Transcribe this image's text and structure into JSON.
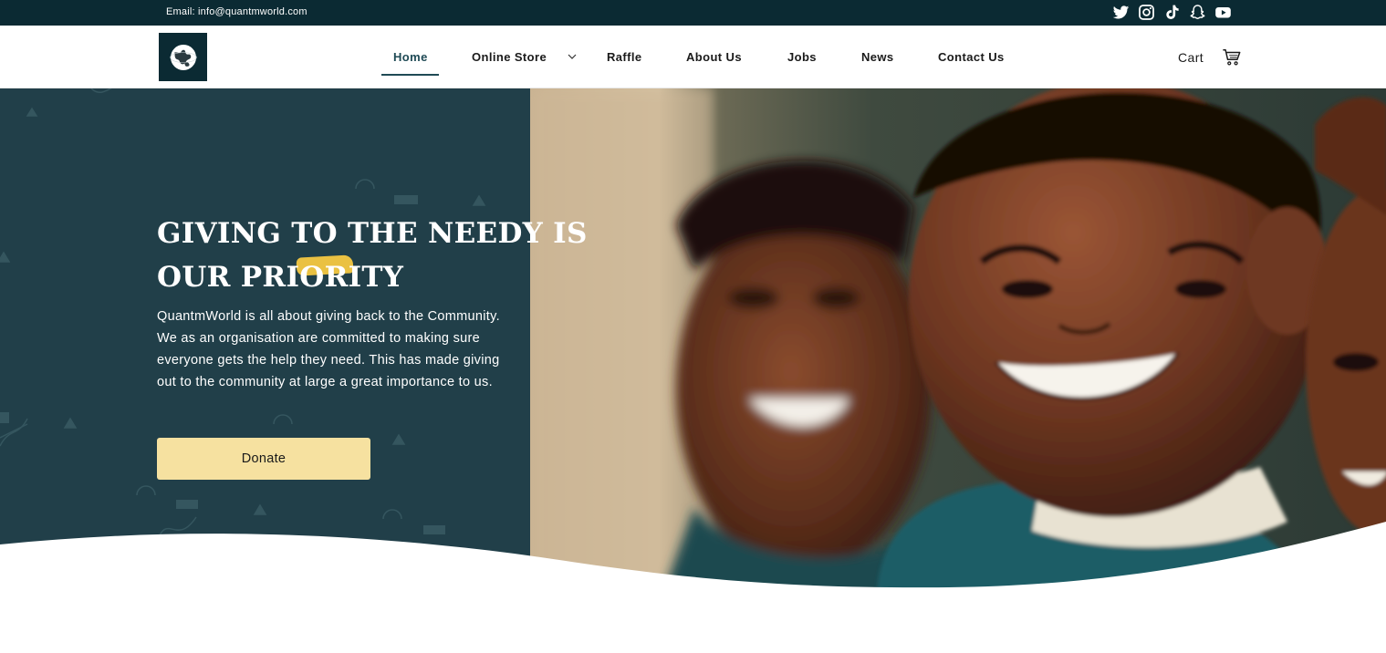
{
  "topbar": {
    "email": "Email: info@quantmworld.com",
    "social_icons": [
      "twitter-icon",
      "instagram-icon",
      "tiktok-icon",
      "snapchat-icon",
      "youtube-icon"
    ]
  },
  "header": {
    "logo_icon": "globe-logo-icon",
    "nav": [
      {
        "label": "Home",
        "active": true
      },
      {
        "label": "Online Store",
        "has_dropdown": true
      },
      {
        "label": "Raffle"
      },
      {
        "label": "About Us"
      },
      {
        "label": "Jobs"
      },
      {
        "label": "News"
      },
      {
        "label": "Contact Us"
      }
    ],
    "cart_label": "Cart",
    "cart_icon": "cart-icon"
  },
  "hero": {
    "title_line1": "Giving to the needy is",
    "title_line2": "our priority",
    "description": "QuantmWorld is all about giving back to the Community. We as an organisation are committed to making sure everyone gets the help they need. This has made giving out to the community at large a great importance to us.",
    "donate_label": "Donate",
    "photo": "smiling-children-photo"
  },
  "colors": {
    "topbar_bg": "#0b2a33",
    "hero_bg": "#213f49",
    "donate_bg": "#f6e1a0",
    "highlight": "#f5c842",
    "nav_active": "#1f4a55"
  }
}
